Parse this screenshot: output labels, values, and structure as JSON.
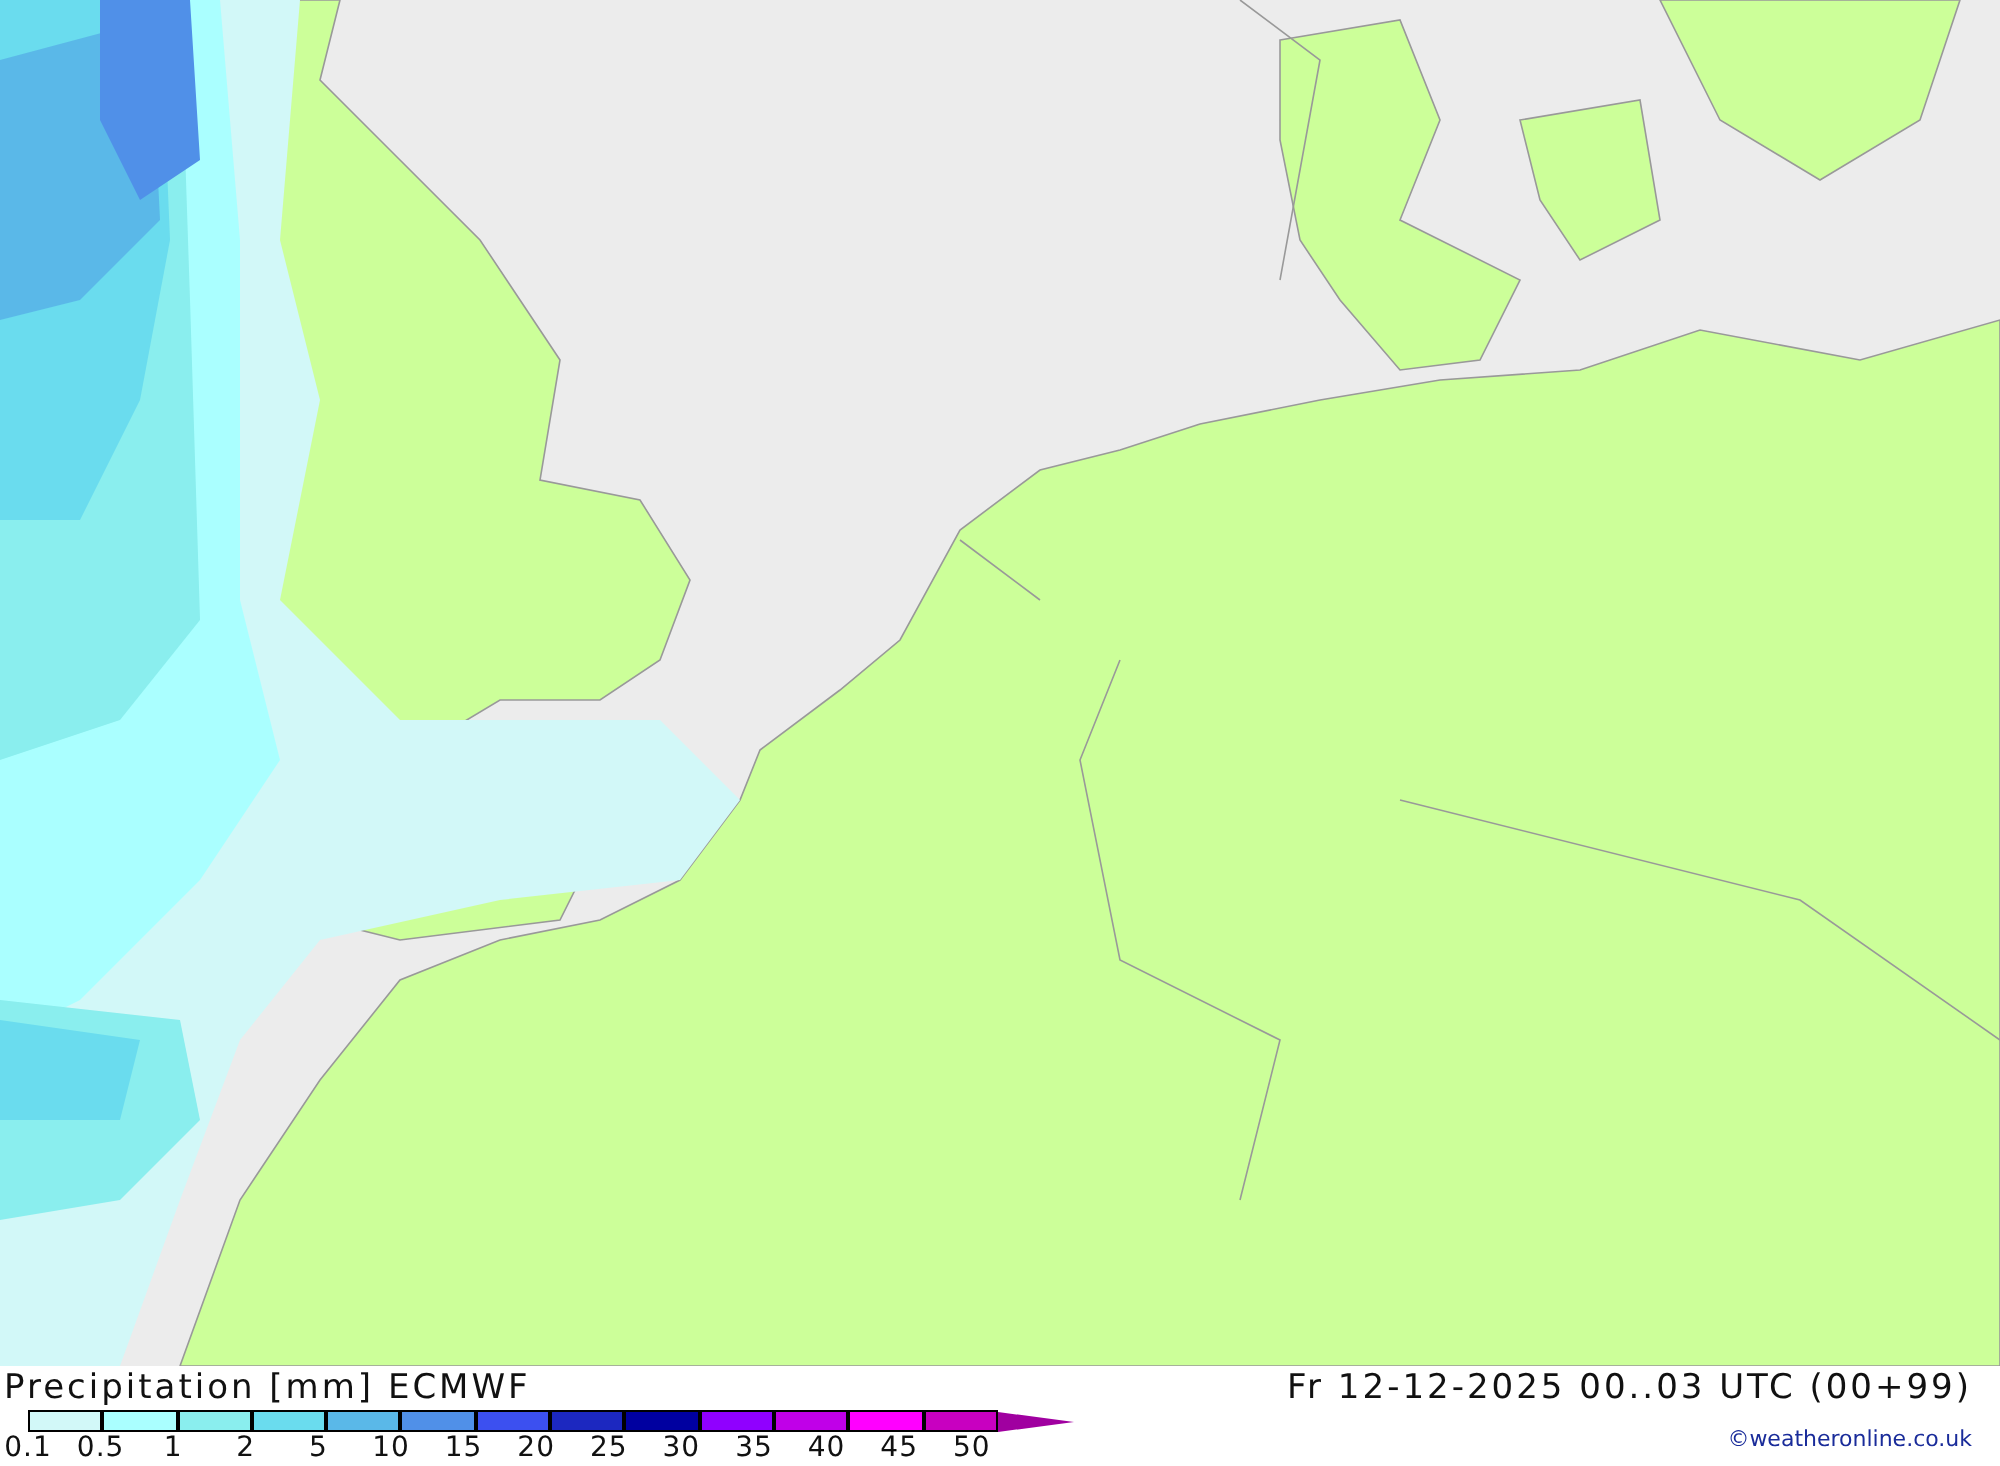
{
  "map": {
    "title": "Precipitation [mm] ECMWF",
    "valid_time": "Fr 12-12-2025 00..03 UTC (00+99)",
    "credit": "©weatheronline.co.uk"
  },
  "legend": {
    "bins": [
      {
        "color": "#d2f8f8"
      },
      {
        "color": "#aaffff"
      },
      {
        "color": "#8aeeee"
      },
      {
        "color": "#6adcee"
      },
      {
        "color": "#5ab8e8"
      },
      {
        "color": "#5090e8"
      },
      {
        "color": "#3c50f0"
      },
      {
        "color": "#1c28c0"
      },
      {
        "color": "#0000a0"
      },
      {
        "color": "#9000ff"
      },
      {
        "color": "#c000e8"
      },
      {
        "color": "#ff00ff"
      },
      {
        "color": "#c800c0"
      }
    ],
    "overflow": {
      "color": "#a000a0"
    },
    "labels": [
      "0.1",
      "0.5",
      "1",
      "2",
      "5",
      "10",
      "15",
      "20",
      "25",
      "30",
      "35",
      "40",
      "45",
      "50"
    ]
  }
}
